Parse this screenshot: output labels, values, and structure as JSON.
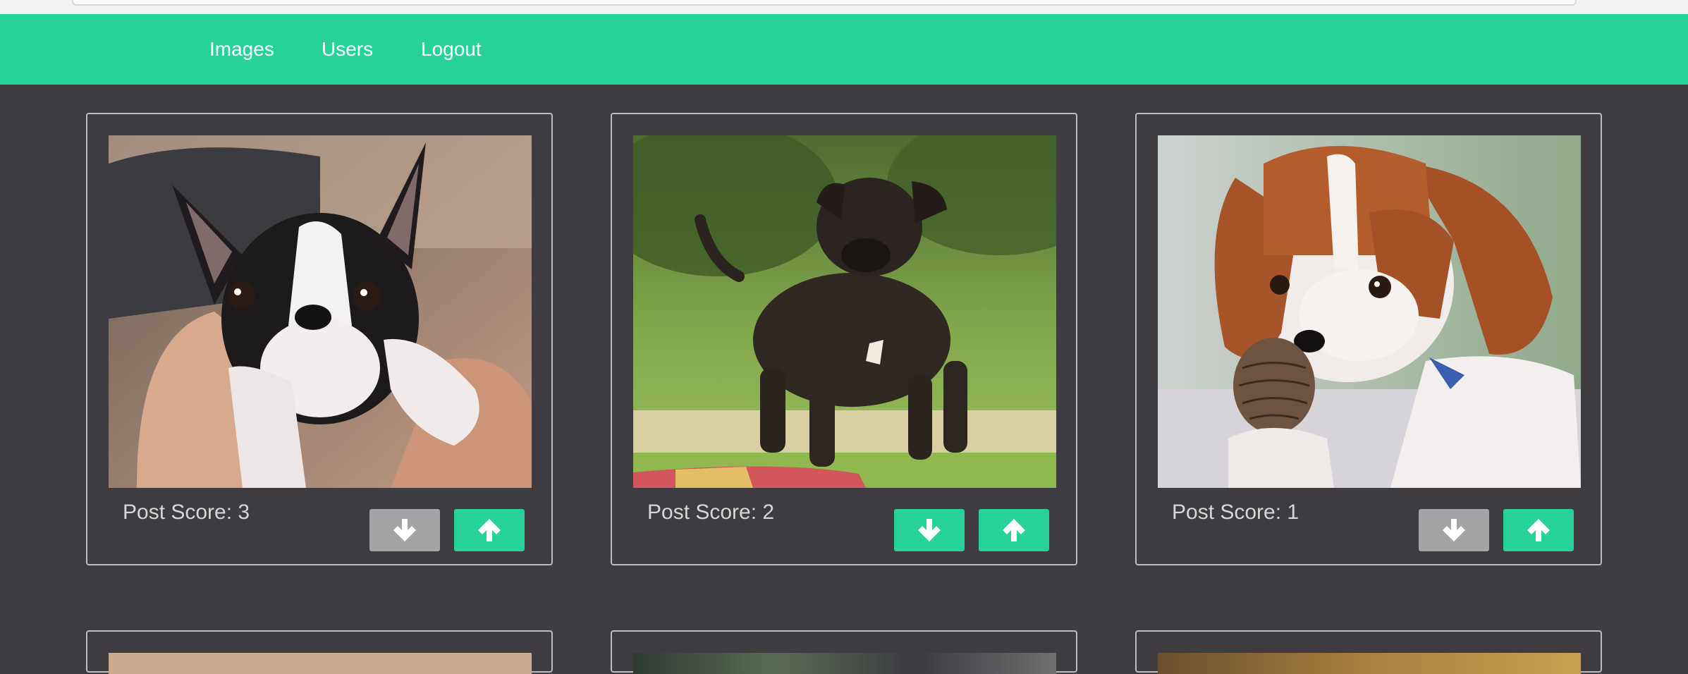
{
  "nav": {
    "links": [
      {
        "label": "Images"
      },
      {
        "label": "Users"
      },
      {
        "label": "Logout"
      }
    ],
    "bg_color": "#27d299"
  },
  "posts": [
    {
      "score_label": "Post Score: 3",
      "photo": "boston-terrier-puppy",
      "downvote_state": "inactive",
      "upvote_state": "active"
    },
    {
      "score_label": "Post Score: 2",
      "photo": "brindle-pug-puppy",
      "downvote_state": "active",
      "upvote_state": "active"
    },
    {
      "score_label": "Post Score: 1",
      "photo": "cavalier-puppy-with-pinecone",
      "downvote_state": "inactive",
      "upvote_state": "active"
    }
  ],
  "icons": {
    "downvote": "arrow-down-icon",
    "upvote": "arrow-up-icon"
  },
  "colors": {
    "page_bg": "#3e3c40",
    "accent": "#27d299",
    "inactive_button": "#a2a4a5",
    "card_border": "#bdbcbf",
    "score_text": "#d6d6d6"
  }
}
